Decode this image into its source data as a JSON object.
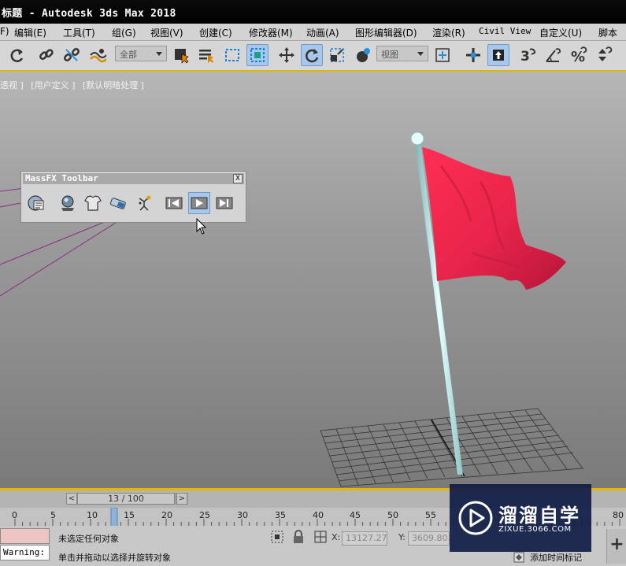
{
  "window": {
    "title": "标题 - Autodesk 3ds Max 2018"
  },
  "menu": {
    "items": [
      {
        "label": "F)"
      },
      {
        "label": "编辑(E)"
      },
      {
        "label": "工具(T)"
      },
      {
        "label": "组(G)"
      },
      {
        "label": "视图(V)"
      },
      {
        "label": "创建(C)"
      },
      {
        "label": "修改器(M)"
      },
      {
        "label": "动画(A)"
      },
      {
        "label": "图形编辑器(D)"
      },
      {
        "label": "渲染(R)"
      },
      {
        "label": "Civil View"
      },
      {
        "label": "自定义(U)"
      },
      {
        "label": "脚本"
      }
    ]
  },
  "toolbar": {
    "selection_filter": "全部",
    "ref_coord": "视图"
  },
  "viewport": {
    "labels": [
      "透视 ]",
      "[用户定义 ]",
      "[默认明暗处理 ]"
    ]
  },
  "massfx": {
    "title": "MassFX Toolbar",
    "close": "X"
  },
  "timeline": {
    "frame_display": "13 / 100",
    "prev": "<",
    "next": ">",
    "ticks": [
      "0",
      "5",
      "10",
      "15",
      "20",
      "25",
      "30",
      "35",
      "40",
      "45",
      "50",
      "55",
      "80"
    ],
    "current_frame": 13
  },
  "status": {
    "warning": "Warning:",
    "selection": "未选定任何对象",
    "prompt": "单击并拖动以选择并旋转对象",
    "x_label": "X:",
    "x_value": "13127.276",
    "y_label": "Y:",
    "y_value": "3609.803",
    "add_time_tag": "添加时间标记"
  },
  "watermark": {
    "brand": "溜溜自学",
    "url": "ZIXUE.3066.COM"
  },
  "colors": {
    "title_bar": "#000000",
    "accent_yellow": "#e1b700",
    "flag_red": "#e8244a",
    "active_button": "#a7c8ea"
  }
}
